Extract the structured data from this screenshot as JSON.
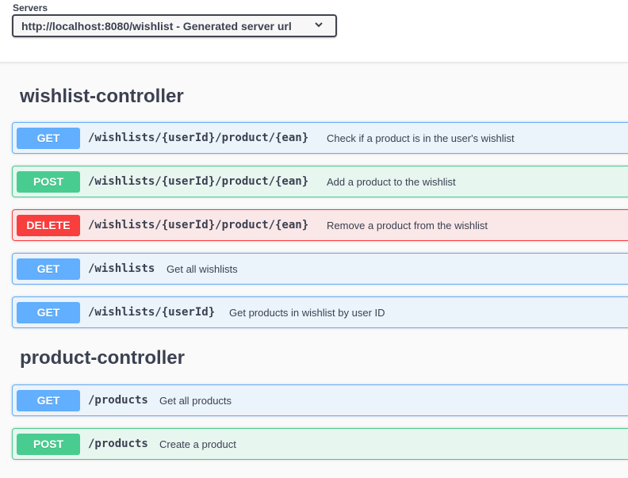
{
  "servers": {
    "label": "Servers",
    "selected": "http://localhost:8080/wishlist - Generated server url"
  },
  "sections": [
    {
      "title": "wishlist-controller",
      "operations": [
        {
          "method": "GET",
          "path": "/wishlists/{userId}/product/{ean}",
          "summary": "Check if a product is in the user's wishlist"
        },
        {
          "method": "POST",
          "path": "/wishlists/{userId}/product/{ean}",
          "summary": "Add a product to the wishlist"
        },
        {
          "method": "DELETE",
          "path": "/wishlists/{userId}/product/{ean}",
          "summary": "Remove a product from the wishlist"
        },
        {
          "method": "GET",
          "path": "/wishlists",
          "summary": "Get all wishlists"
        },
        {
          "method": "GET",
          "path": "/wishlists/{userId}",
          "summary": "Get products in wishlist by user ID"
        }
      ]
    },
    {
      "title": "product-controller",
      "operations": [
        {
          "method": "GET",
          "path": "/products",
          "summary": "Get all products"
        },
        {
          "method": "POST",
          "path": "/products",
          "summary": "Create a product"
        }
      ]
    }
  ],
  "colors": {
    "get": "#61affe",
    "post": "#49cc90",
    "delete": "#f93e3e"
  },
  "icons": {
    "server_dropdown": "chevron-down-icon"
  }
}
